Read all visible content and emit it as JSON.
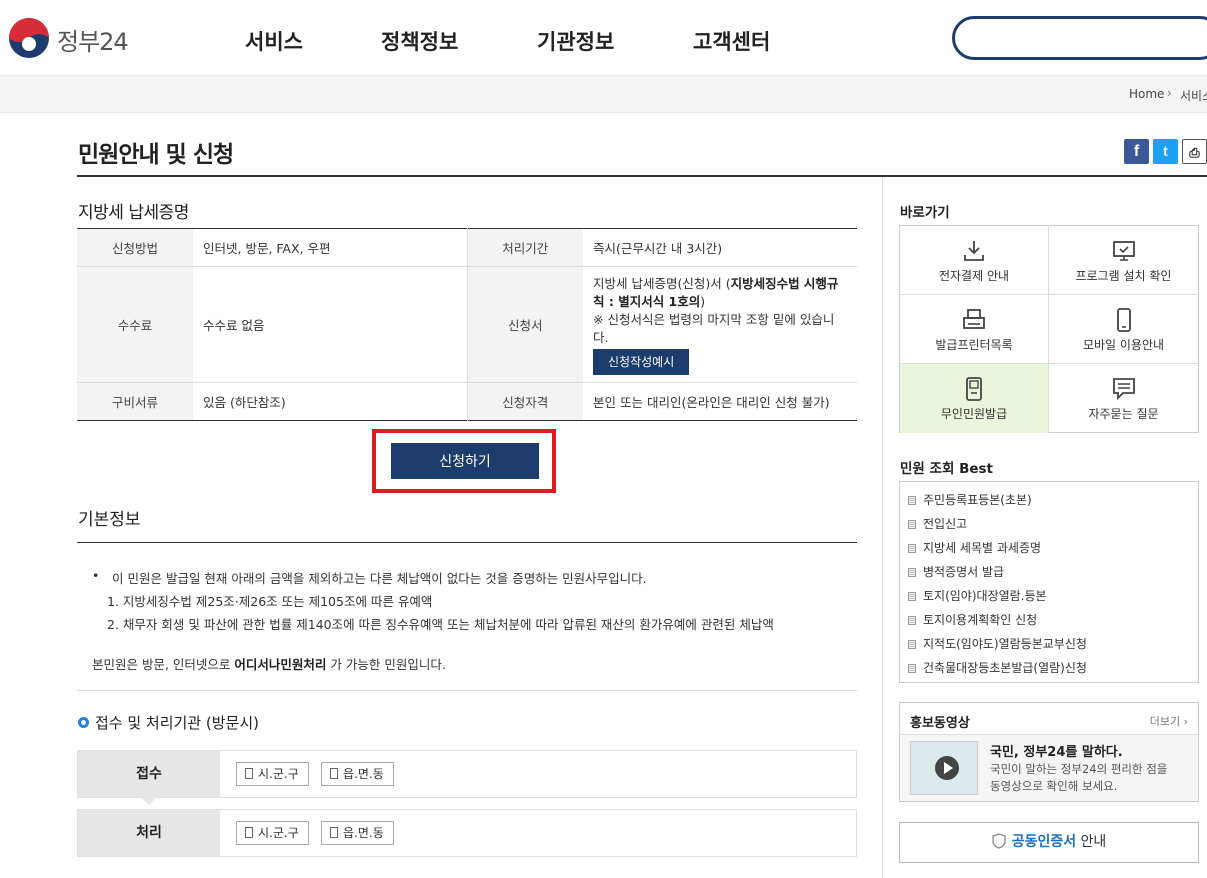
{
  "header": {
    "logo_text": "정부24",
    "nav": [
      "서비스",
      "정책정보",
      "기관정보",
      "고객센터"
    ],
    "search_placeholder": ""
  },
  "location": {
    "home": "Home",
    "current": "서비스"
  },
  "page_title": "민원안내 및 신청",
  "share": {
    "facebook": "f",
    "twitter": "t",
    "print": "⎙"
  },
  "section_title": "지방세 납세증명",
  "info_table": {
    "method_label": "신청방법",
    "method": "인터넷, 방문, FAX, 우편",
    "period_label": "처리기간",
    "period": "즉시(근무시간 내 3시간)",
    "fee_label": "수수료",
    "fee": "수수료 없음",
    "form_label": "신청서",
    "form_text_1": "지방세 납세증명(신청)서 (",
    "form_text_bold": "지방세징수법 시행규칙 : 별지서식 1호의",
    "form_text_2": ")",
    "form_note": "※ 신청서식은 법령의 마지막 조항 밑에 있습니다.",
    "form_example_btn": "신청작성예시",
    "docs_label": "구비서류",
    "docs": "있음 (하단참조)",
    "qual_label": "신청자격",
    "qual": "본인 또는 대리인(온라인은 대리인 신청 불가)"
  },
  "apply_button": "신청하기",
  "basic": {
    "title": "기본정보",
    "bullet": "•",
    "desc": "이 민원은 발급일 현재 아래의 금액을 제외하고는 다른 체납액이 없다는 것을 증명하는 민원사무입니다.",
    "item1": "1. 지방세징수법 제25조·제26조 또는 제105조에 따른 유예액",
    "item2": "2. 채무자 회생 및 파산에 관한 법률 제140조에 따른 징수유예액 또는 체납처분에 따라 압류된 재산의 환가유예에 관련된 체납액",
    "note_1": "본민원은 방문, 인터넷으로 ",
    "note_bold": "어디서나민원처리",
    "note_2": " 가 가능한 민원입니다."
  },
  "agency": {
    "title": "접수 및 처리기관 (방문시)",
    "receive_label": "접수",
    "process_label": "처리",
    "chips": [
      "시.군.구",
      "읍.면.동"
    ]
  },
  "sidebar": {
    "quick_title": "바로가기",
    "quick": [
      {
        "label": "전자결제 안내",
        "icon": "download-icon"
      },
      {
        "label": "프로그램 설치 확인",
        "icon": "monitor-icon"
      },
      {
        "label": "발급프린터목록",
        "icon": "printer-icon"
      },
      {
        "label": "모바일 이용안내",
        "icon": "mobile-icon"
      },
      {
        "label": "무인민원발급",
        "icon": "kiosk-icon"
      },
      {
        "label": "자주묻는 질문",
        "icon": "chat-icon"
      }
    ],
    "best_title": "민원 조회 Best",
    "best": [
      "주민등록표등본(초본)",
      "전입신고",
      "지방세 세목별 과세증명",
      "병적증명서 발급",
      "토지(임야)대장열람.등본",
      "토지이용계획확인 신청",
      "지적도(임야도)열람등본교부신청",
      "건축물대장등초본발급(열람)신청"
    ],
    "promo_title": "홍보동영상",
    "promo_more": "더보기 ›",
    "promo_heading": "국민, 정부24를 말하다.",
    "promo_desc1": "국민이 말하는 정부24의 편리한 점을",
    "promo_desc2": "동영상으로 확인해 보세요.",
    "cert_em": "공동인증서",
    "cert_rest": " 안내"
  }
}
